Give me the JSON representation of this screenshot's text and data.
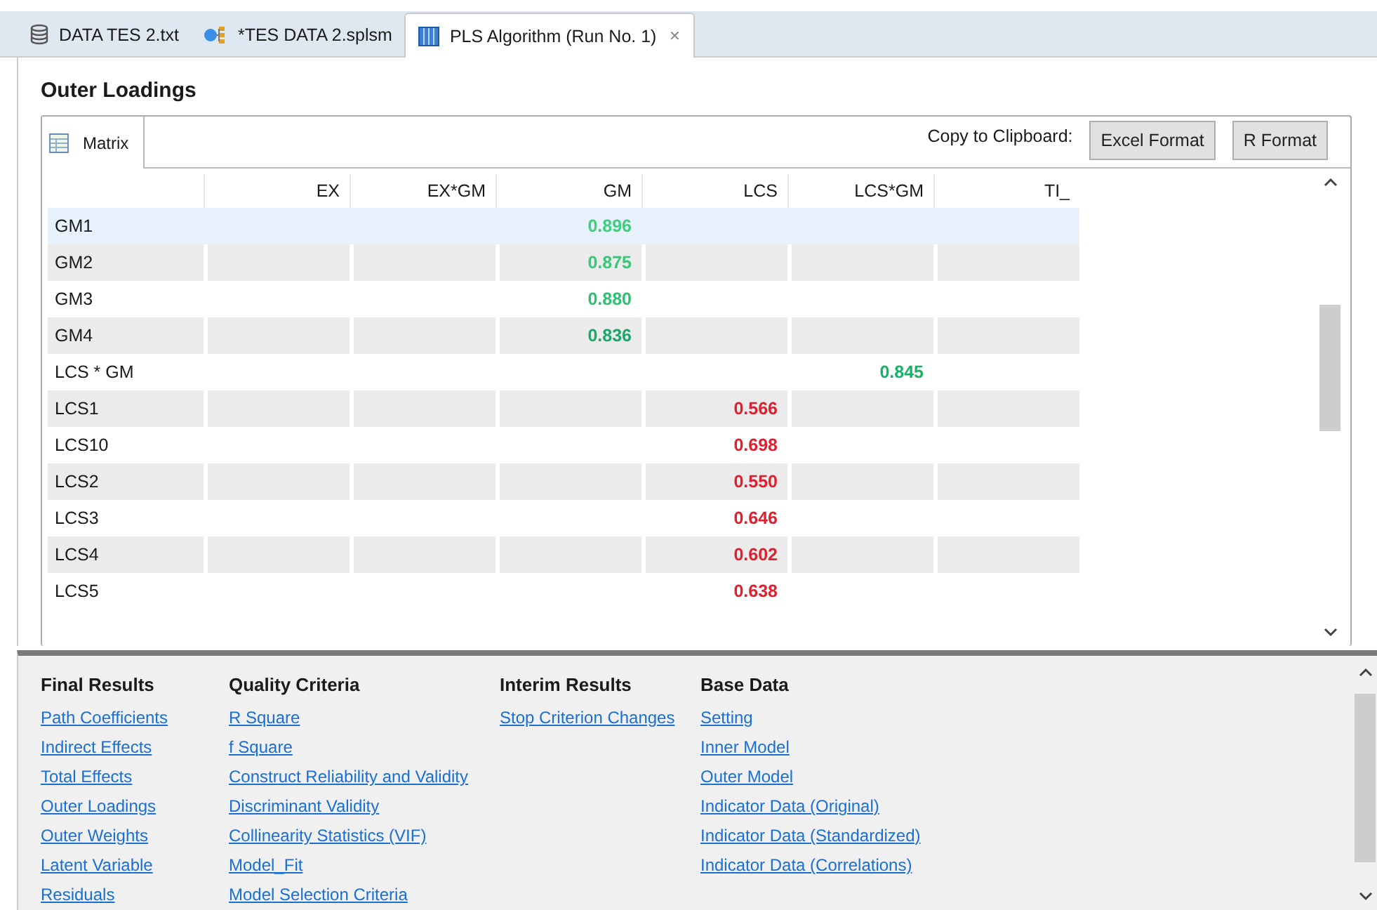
{
  "editor_tabs": [
    {
      "kind": "database",
      "label": "DATA TES 2.txt",
      "selected": false
    },
    {
      "kind": "model",
      "label": "*TES DATA 2.splsm",
      "selected": false
    },
    {
      "kind": "table",
      "label": "PLS Algorithm (Run No. 1)",
      "selected": true,
      "close": "✕"
    }
  ],
  "title": "Outer Loadings",
  "view_tabs": [
    {
      "label": "Matrix",
      "selected": true
    }
  ],
  "clipboard": {
    "label": "Copy to Clipboard:",
    "buttons": [
      "Excel Format",
      "R Format"
    ]
  },
  "table": {
    "columns": [
      "EX",
      "EX*GM",
      "GM",
      "LCS",
      "LCS*GM",
      "TI_"
    ],
    "rows": [
      {
        "label": "GM1",
        "selected": true,
        "cells": [
          null,
          null,
          {
            "value": "0.896",
            "color": "#3ccf7c"
          },
          null,
          null,
          null
        ]
      },
      {
        "label": "GM2",
        "selected": false,
        "cells": [
          null,
          null,
          {
            "value": "0.875",
            "color": "#36c977"
          },
          null,
          null,
          null
        ]
      },
      {
        "label": "GM3",
        "selected": false,
        "cells": [
          null,
          null,
          {
            "value": "0.880",
            "color": "#2fc072"
          },
          null,
          null,
          null
        ]
      },
      {
        "label": "GM4",
        "selected": false,
        "cells": [
          null,
          null,
          {
            "value": "0.836",
            "color": "#1aa86a"
          },
          null,
          null,
          null
        ]
      },
      {
        "label": "LCS * GM",
        "selected": false,
        "cells": [
          null,
          null,
          null,
          null,
          {
            "value": "0.845",
            "color": "#16b268"
          },
          null
        ]
      },
      {
        "label": "LCS1",
        "selected": false,
        "cells": [
          null,
          null,
          null,
          {
            "value": "0.566",
            "color": "#e0202f"
          },
          null,
          null
        ]
      },
      {
        "label": "LCS10",
        "selected": false,
        "cells": [
          null,
          null,
          null,
          {
            "value": "0.698",
            "color": "#e0202f"
          },
          null,
          null
        ]
      },
      {
        "label": "LCS2",
        "selected": false,
        "cells": [
          null,
          null,
          null,
          {
            "value": "0.550",
            "color": "#e0202f"
          },
          null,
          null
        ]
      },
      {
        "label": "LCS3",
        "selected": false,
        "cells": [
          null,
          null,
          null,
          {
            "value": "0.646",
            "color": "#e0202f"
          },
          null,
          null
        ]
      },
      {
        "label": "LCS4",
        "selected": false,
        "cells": [
          null,
          null,
          null,
          {
            "value": "0.602",
            "color": "#e0202f"
          },
          null,
          null
        ]
      },
      {
        "label": "LCS5",
        "selected": false,
        "cells": [
          null,
          null,
          null,
          {
            "value": "0.638",
            "color": "#e0202f"
          },
          null,
          null
        ]
      }
    ]
  },
  "link_groups": [
    {
      "heading": "Final Results",
      "links": [
        "Path Coefficients",
        "Indirect Effects",
        "Total Effects",
        "Outer Loadings",
        "Outer Weights",
        "Latent Variable",
        "Residuals"
      ]
    },
    {
      "heading": "Quality Criteria",
      "links": [
        "R Square",
        "f Square",
        "Construct Reliability and Validity",
        "Discriminant Validity",
        "Collinearity Statistics (VIF)",
        "Model_Fit",
        "Model Selection Criteria"
      ]
    },
    {
      "heading": "Interim Results",
      "links": [
        "Stop Criterion Changes"
      ]
    },
    {
      "heading": "Base Data",
      "links": [
        "Setting",
        "Inner Model",
        "Outer Model",
        "Indicator Data (Original)",
        "Indicator Data (Standardized)",
        "Indicator Data (Correlations)"
      ]
    }
  ]
}
